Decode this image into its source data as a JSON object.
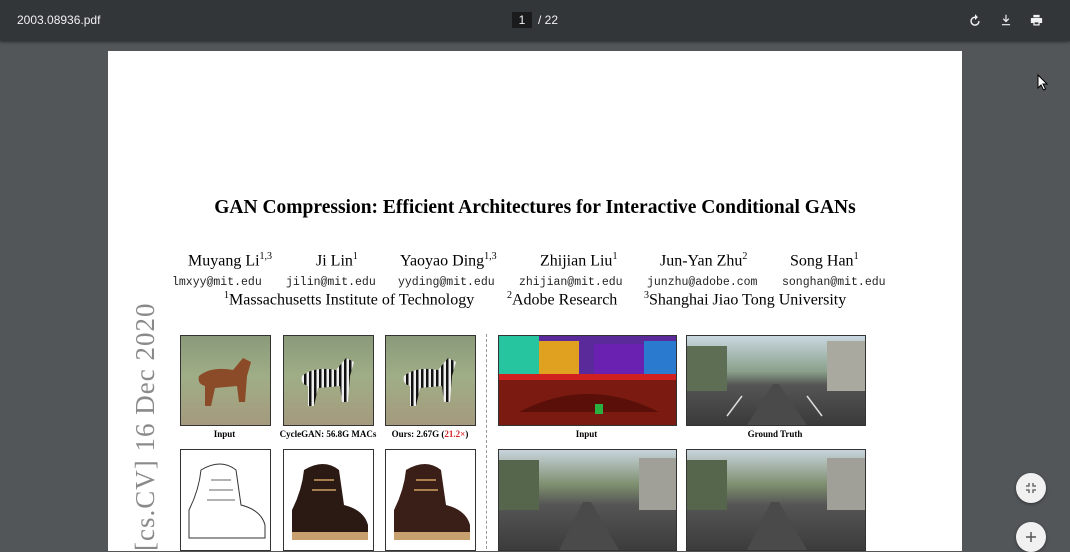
{
  "toolbar": {
    "filename": "2003.08936.pdf",
    "current_page": "1",
    "page_total": "/ 22",
    "rotate_icon": "rotate-icon",
    "download_icon": "download-icon",
    "print_icon": "print-icon"
  },
  "paper": {
    "title": "GAN Compression: Efficient Architectures for Interactive Conditional GANs",
    "authors": [
      {
        "name": "Muyang Li",
        "sup": "1,3",
        "email": "lmxyy@mit.edu"
      },
      {
        "name": "Ji Lin",
        "sup": "1",
        "email": "jilin@mit.edu"
      },
      {
        "name": "Yaoyao Ding",
        "sup": "1,3",
        "email": "yyding@mit.edu"
      },
      {
        "name": "Zhijian Liu",
        "sup": "1",
        "email": "zhijian@mit.edu"
      },
      {
        "name": "Jun-Yan Zhu",
        "sup": "2",
        "email": "junzhu@adobe.com"
      },
      {
        "name": "Song Han",
        "sup": "1",
        "email": "songhan@mit.edu"
      }
    ],
    "affiliations": [
      {
        "sup": "1",
        "name": "Massachusetts Institute of Technology"
      },
      {
        "sup": "2",
        "name": "Adobe Research"
      },
      {
        "sup": "3",
        "name": "Shanghai Jiao Tong University"
      }
    ],
    "arxiv_stamp": "[cs.CV]  16 Dec 2020",
    "captions": {
      "input1": "Input",
      "cyclegan": "CycleGAN: 56.8G MACs",
      "ours_prefix": "Ours: 2.67G (",
      "ours_speedup": "21.2×",
      "ours_suffix": ")",
      "input2": "Input",
      "ground_truth": "Ground Truth"
    },
    "colors": {
      "speedup": "#d62728"
    }
  },
  "side_buttons": {
    "fit_icon": "fit-page-icon",
    "zoom_in_icon": "zoom-in-icon"
  }
}
